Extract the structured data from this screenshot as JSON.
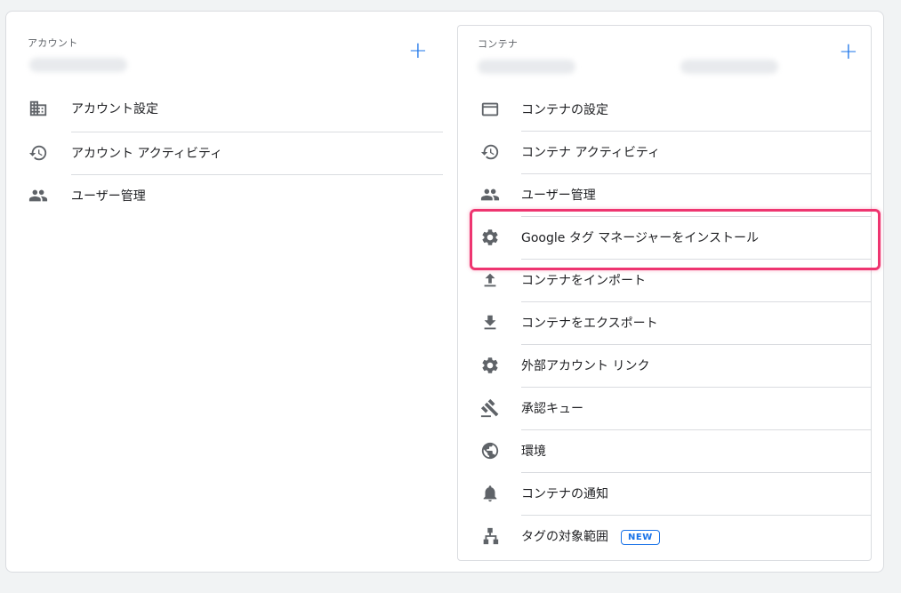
{
  "account": {
    "section_label": "アカウント",
    "add_label": "+",
    "items": [
      {
        "label": "アカウント設定",
        "icon": "building-icon"
      },
      {
        "label": "アカウント アクティビティ",
        "icon": "history-icon"
      },
      {
        "label": "ユーザー管理",
        "icon": "people-icon"
      }
    ]
  },
  "container": {
    "section_label": "コンテナ",
    "add_label": "+",
    "items": [
      {
        "label": "コンテナの設定",
        "icon": "web-window-icon"
      },
      {
        "label": "コンテナ アクティビティ",
        "icon": "history-icon"
      },
      {
        "label": "ユーザー管理",
        "icon": "people-icon"
      },
      {
        "label": "Google タグ マネージャーをインストール",
        "icon": "gear-icon"
      },
      {
        "label": "コンテナをインポート",
        "icon": "upload-icon"
      },
      {
        "label": "コンテナをエクスポート",
        "icon": "download-icon"
      },
      {
        "label": "外部アカウント リンク",
        "icon": "gear-icon"
      },
      {
        "label": "承認キュー",
        "icon": "gavel-icon"
      },
      {
        "label": "環境",
        "icon": "globe-icon"
      },
      {
        "label": "コンテナの通知",
        "icon": "bell-icon"
      },
      {
        "label": "タグの対象範囲",
        "icon": "hierarchy-icon",
        "badge": "NEW"
      }
    ]
  },
  "colors": {
    "accent": "#1a73e8",
    "highlight": "#ee3570",
    "icon": "#5f6368"
  }
}
